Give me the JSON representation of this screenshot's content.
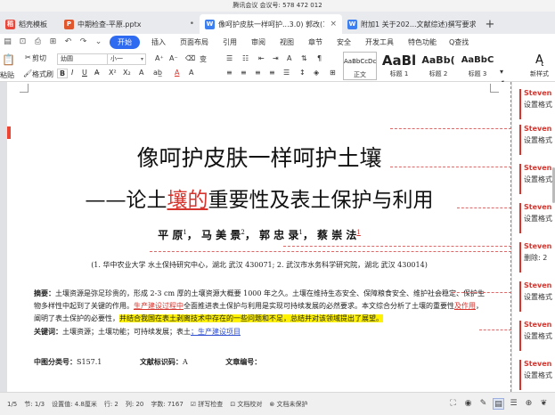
{
  "meeting_bar": "腾讯会议 会议号: 578 472 012",
  "tabs": [
    {
      "label": "稻壳模板",
      "icon": "docer-icon",
      "color": "#e8483b"
    },
    {
      "label": "中期检查-平原.pptx",
      "icon": "ppt-icon",
      "color": "#e0572e"
    },
    {
      "label": "像呵护皮肤一样呵护...3.0) 郭改(1)",
      "icon": "word-icon",
      "color": "#3b7ff0",
      "active": true
    },
    {
      "label": "附加1 关于202...文献综述)撰写要求",
      "icon": "word-icon",
      "color": "#3b7ff0"
    }
  ],
  "tab_close": "×",
  "tab_add": "+",
  "menu": {
    "start": "开始",
    "items": [
      "插入",
      "页面布局",
      "引用",
      "审阅",
      "视图",
      "章节",
      "安全",
      "开发工具",
      "特色功能"
    ],
    "search": "Q查找"
  },
  "ribbon": {
    "paste": "粘贴",
    "cut": "剪切",
    "format_painter": "格式刷",
    "font_name": "幼圆",
    "font_size": "小一",
    "bold": "B",
    "italic": "I",
    "underline": "U",
    "grow": "A⁺",
    "shrink": "A⁻",
    "styles": [
      {
        "sample": "AaBbCcDc",
        "name": "正文"
      },
      {
        "sample": "AaBl",
        "name": "标题 1"
      },
      {
        "sample": "AaBb(",
        "name": "标题 2"
      },
      {
        "sample": "AaBbC",
        "name": "标题 3"
      }
    ],
    "new_style": "新样式"
  },
  "document": {
    "title_line1": "像呵护皮肤一样呵护土壤",
    "title_line2_prefix": "——论土",
    "title_line2_deleted": "壤的",
    "title_line2_suffix": "重要性及表土保护与利用",
    "authors": [
      {
        "name": "平 原",
        "sup": "1"
      },
      {
        "name": "马 美 景",
        "sup": "2"
      },
      {
        "name": "郭 忠 录",
        "sup": "1"
      },
      {
        "name": "蔡 崇 法",
        "sup": "1"
      }
    ],
    "affiliation": "(1. 华中农业大学 水土保持研究中心，湖北 武汉 430071; 2. 武汉市水务科学研究院，湖北 武汉   430014)",
    "abstract_label": "摘要：",
    "abstract_p1": "土壤资源是弥足珍贵的，形成 2-3 cm 厚的土壤资源大概要 1000 年之久。土壤在维持生态安全、保障粮食安全、维护社会稳定、保护生物多样性中起到了关键的作用。",
    "abstract_ins1": "生产建设过程中",
    "abstract_p2": "全面推进表土保护与利用是实现可持续发展的必然要求。本文综合分析了土壤的重要性",
    "abstract_ins2": "及作用",
    "abstract_p3": "，阐明了表土保护的必要性，",
    "abstract_hl": "并结合我国在表土剥离技术中存在的一些问题和不足，总结并对该领域提出了展望。",
    "kw_label": "关键词：",
    "kw_text": "土壤资源；土壤功能；可持续发展；表土",
    "kw_ins": "；生产建设项目",
    "cls_label": "中图分类号：",
    "cls_value": "S157.1",
    "doc_label": "文献标识码：",
    "doc_value": "A",
    "art_label": "文章编号："
  },
  "comments": [
    {
      "author": "Steven",
      "text": "设置格式"
    },
    {
      "author": "Steven",
      "text": "设置格式"
    },
    {
      "author": "Steven",
      "text": "设置格式"
    },
    {
      "author": "Steven",
      "text": "设置格式"
    },
    {
      "author": "Steven",
      "text": "删除: 2"
    },
    {
      "author": "Steven",
      "text": "设置格式"
    },
    {
      "author": "Steven",
      "text": "设置格式"
    },
    {
      "author": "Steven",
      "text": "设置格式"
    },
    {
      "author": "Steven",
      "text": "设置格式"
    }
  ],
  "status": {
    "page": "1/5",
    "section": "节: 1/3",
    "setting": "设置值: 4.8厘米",
    "row": "行: 2",
    "col": "列: 20",
    "words": "字数: 7167",
    "spell": "拼写检查",
    "proof": "文档校对",
    "protect": "文档未保护"
  }
}
